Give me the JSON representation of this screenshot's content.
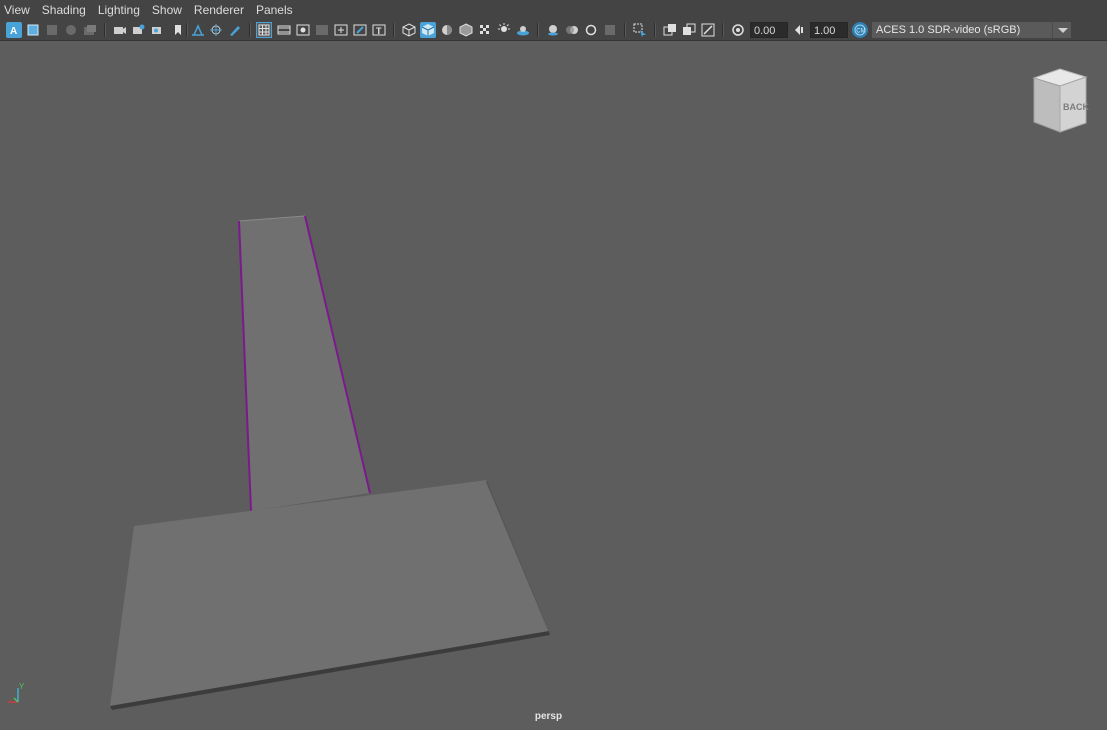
{
  "menu": [
    "View",
    "Shading",
    "Lighting",
    "Show",
    "Renderer",
    "Panels"
  ],
  "toolbar": {
    "exposure_value": "0.00",
    "gamma_value": "1.00",
    "color_space": "ACES 1.0 SDR-video (sRGB)"
  },
  "viewport": {
    "camera_label": "persp",
    "viewcube_label": "BACK",
    "axis_label": "Y"
  },
  "colors": {
    "background": "#5d5d5d",
    "toolbar": "#444444",
    "active_icon": "#4aa3d8",
    "selected_edge": "#7a1a8c",
    "mesh": "#707070"
  }
}
